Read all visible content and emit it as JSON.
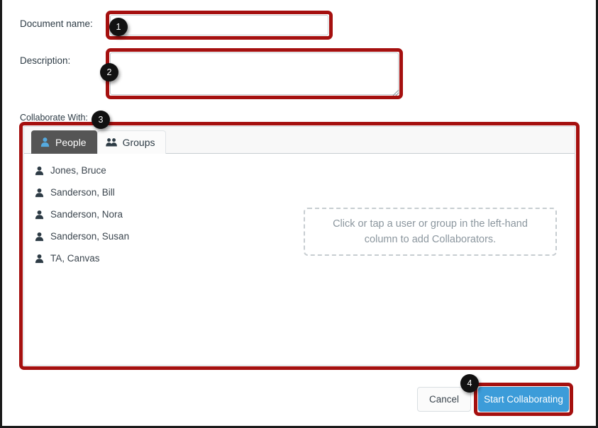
{
  "form": {
    "document_name": {
      "label": "Document name:",
      "value": "",
      "placeholder": ""
    },
    "description": {
      "label": "Description:",
      "value": "",
      "placeholder": ""
    },
    "collaborate_with": {
      "label": "Collaborate With:"
    }
  },
  "tabs": [
    {
      "label": "People",
      "icon": "person-icon",
      "active": true
    },
    {
      "label": "Groups",
      "icon": "group-icon",
      "active": false
    }
  ],
  "people": [
    {
      "name": "Jones, Bruce",
      "icon": "person-icon"
    },
    {
      "name": "Sanderson, Bill",
      "icon": "person-icon"
    },
    {
      "name": "Sanderson, Nora",
      "icon": "person-icon"
    },
    {
      "name": "Sanderson, Susan",
      "icon": "person-icon"
    },
    {
      "name": "TA, Canvas",
      "icon": "person-icon"
    }
  ],
  "drop_hint": {
    "line1": "Click or tap a user or group in the left-hand",
    "line2": "column to add Collaborators."
  },
  "footer": {
    "cancel_label": "Cancel",
    "submit_label": "Start Collaborating"
  },
  "annotations": [
    {
      "number": "1",
      "target": "document-name-field"
    },
    {
      "number": "2",
      "target": "description-field"
    },
    {
      "number": "3",
      "target": "collaborate-panel"
    },
    {
      "number": "4",
      "target": "start-collaborating-button"
    }
  ],
  "colors": {
    "annotation_red": "#a5100f",
    "badge_black": "#111111",
    "primary_blue": "#3c9cd9",
    "active_tab_gray": "#555555",
    "tab_icon_blue": "#55aae0",
    "text_dark": "#2d3b45",
    "hint_gray": "#8b969e"
  }
}
